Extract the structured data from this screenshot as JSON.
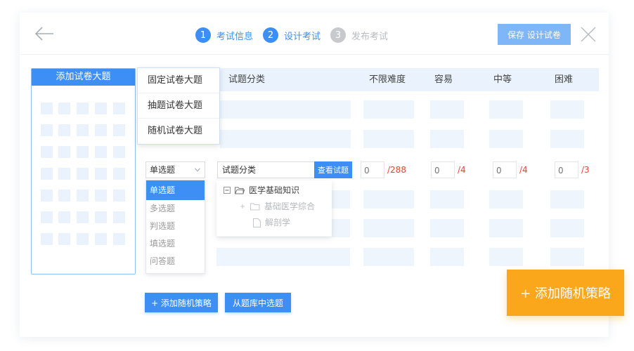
{
  "header": {
    "steps": [
      {
        "num": "1",
        "label": "考试信息",
        "state": "active"
      },
      {
        "num": "2",
        "label": "设计考试",
        "state": "active"
      },
      {
        "num": "3",
        "label": "发布考试",
        "state": "inactive"
      }
    ],
    "save_label": "保存 设计试卷"
  },
  "left_panel": {
    "title": "添加试卷大题"
  },
  "section_menu": {
    "items": [
      "固定试卷大题",
      "抽题试卷大题",
      "随机试卷大题"
    ]
  },
  "table": {
    "headers": [
      "试题分类",
      "不限难度",
      "容易",
      "中等",
      "困难"
    ]
  },
  "active_row": {
    "type_value": "单选题",
    "category_value": "试题分类",
    "view_button": "查看试题",
    "counts": [
      {
        "value": "0",
        "max": "/288"
      },
      {
        "value": "0",
        "max": "/4"
      },
      {
        "value": "0",
        "max": "/4"
      },
      {
        "value": "0",
        "max": "/3"
      }
    ]
  },
  "type_options": [
    "单选题",
    "多选题",
    "判选题",
    "填选题",
    "问答题"
  ],
  "tree": {
    "root": "医学基础知识",
    "child_folder": "基础医学综合",
    "child_file": "解剖学"
  },
  "buttons": {
    "add_random": "+ 添加随机策略",
    "from_bank": "从题库中选题",
    "add_random_big": "+ 添加随机策略"
  },
  "colors": {
    "primary": "#3d8ff5",
    "accent": "#fba71b",
    "danger": "#e2463b"
  }
}
